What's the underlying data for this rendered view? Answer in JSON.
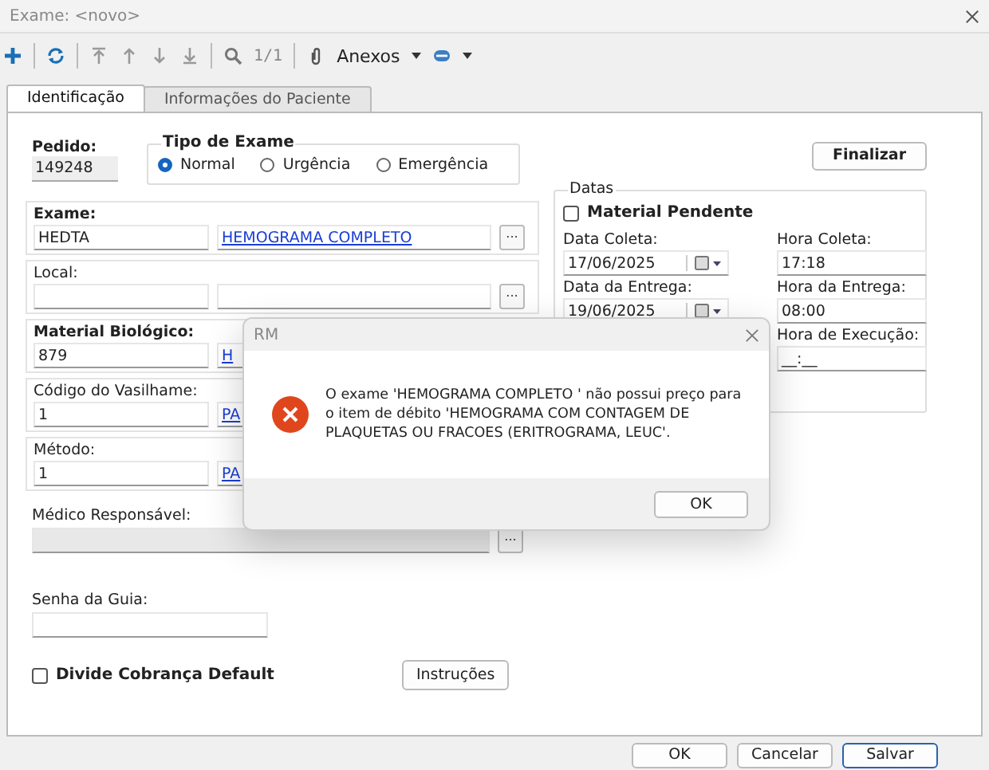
{
  "window": {
    "title": "Exame: <novo>"
  },
  "toolbar": {
    "counter": "1/1",
    "attachments": "Anexos"
  },
  "tabs": [
    {
      "label": "Identificação",
      "selected": true
    },
    {
      "label": "Informações do Paciente",
      "selected": false
    }
  ],
  "pedido": {
    "label": "Pedido:",
    "value": "149248"
  },
  "tipo_exame": {
    "title": "Tipo de Exame",
    "options": [
      {
        "label": "Normal",
        "selected": true
      },
      {
        "label": "Urgência",
        "selected": false
      },
      {
        "label": "Emergência",
        "selected": false
      }
    ]
  },
  "finalizar": "Finalizar",
  "lookups": [
    {
      "label": "Exame:",
      "bold": true,
      "code": "HEDTA",
      "name": "HEMOGRAMA COMPLETO ",
      "browse": "..."
    },
    {
      "label": "Local:",
      "bold": false,
      "browse": "..."
    },
    {
      "label": "Material Biológico:",
      "bold": true,
      "code": "879",
      "name": "H"
    },
    {
      "label": "Código do Vasilhame:",
      "bold": false,
      "code": "1",
      "name": "PA"
    },
    {
      "label": "Método:",
      "bold": false,
      "code": "1",
      "name": "PA"
    }
  ],
  "medico": {
    "label": "Médico Responsável:",
    "disabled": true,
    "browse": "..."
  },
  "datas": {
    "title": "Datas",
    "material_pendente": {
      "label": "Material Pendente",
      "checked": false
    },
    "fields": [
      {
        "label": "Data Coleta:",
        "value": "17/06/2025",
        "kind": "date"
      },
      {
        "label": "Hora Coleta:",
        "value": "17:18",
        "kind": "time"
      },
      {
        "label": "Data da Entrega:",
        "value": "19/06/2025",
        "kind": "date"
      },
      {
        "label": "Hora da Entrega:",
        "value": "08:00",
        "kind": "time"
      },
      {
        "label": "Hora de Execução:",
        "value": "__:__",
        "kind": "time"
      }
    ]
  },
  "senha": {
    "label": "Senha da Guia:"
  },
  "divide": {
    "label": "Divide Cobrança Default",
    "checked": false
  },
  "instrucoes": "Instruções",
  "buttons": [
    {
      "label": "OK",
      "default": false
    },
    {
      "label": "Cancelar",
      "default": false
    },
    {
      "label": "Salvar",
      "default": true
    }
  ],
  "dialog": {
    "title": "RM",
    "message": "O exame 'HEMOGRAMA COMPLETO ' não possui preço para o item de débito 'HEMOGRAMA COM CONTAGEM DE PLAQUETAS OU FRACOES (ERITROGRAMA, LEUC'.",
    "button": "OK"
  }
}
